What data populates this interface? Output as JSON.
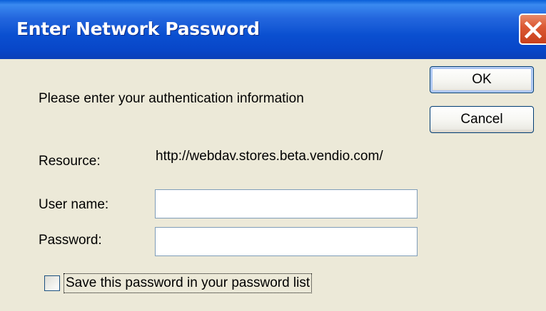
{
  "dialog": {
    "title": "Enter Network Password",
    "prompt": "Please enter your authentication information",
    "resource_label": "Resource:",
    "resource_value": "http://webdav.stores.beta.vendio.com/",
    "username_label": "User name:",
    "username_value": "",
    "password_label": "Password:",
    "password_value": "",
    "save_password_label": "Save this password in your password list",
    "save_password_checked": false
  },
  "buttons": {
    "ok_label": "OK",
    "cancel_label": "Cancel"
  },
  "icons": {
    "close": "close-icon"
  },
  "colors": {
    "titlebar": "#0a4fd0",
    "close_button": "#dc5a35",
    "dialog_background": "#ece9d8",
    "input_border": "#7f9db9"
  }
}
